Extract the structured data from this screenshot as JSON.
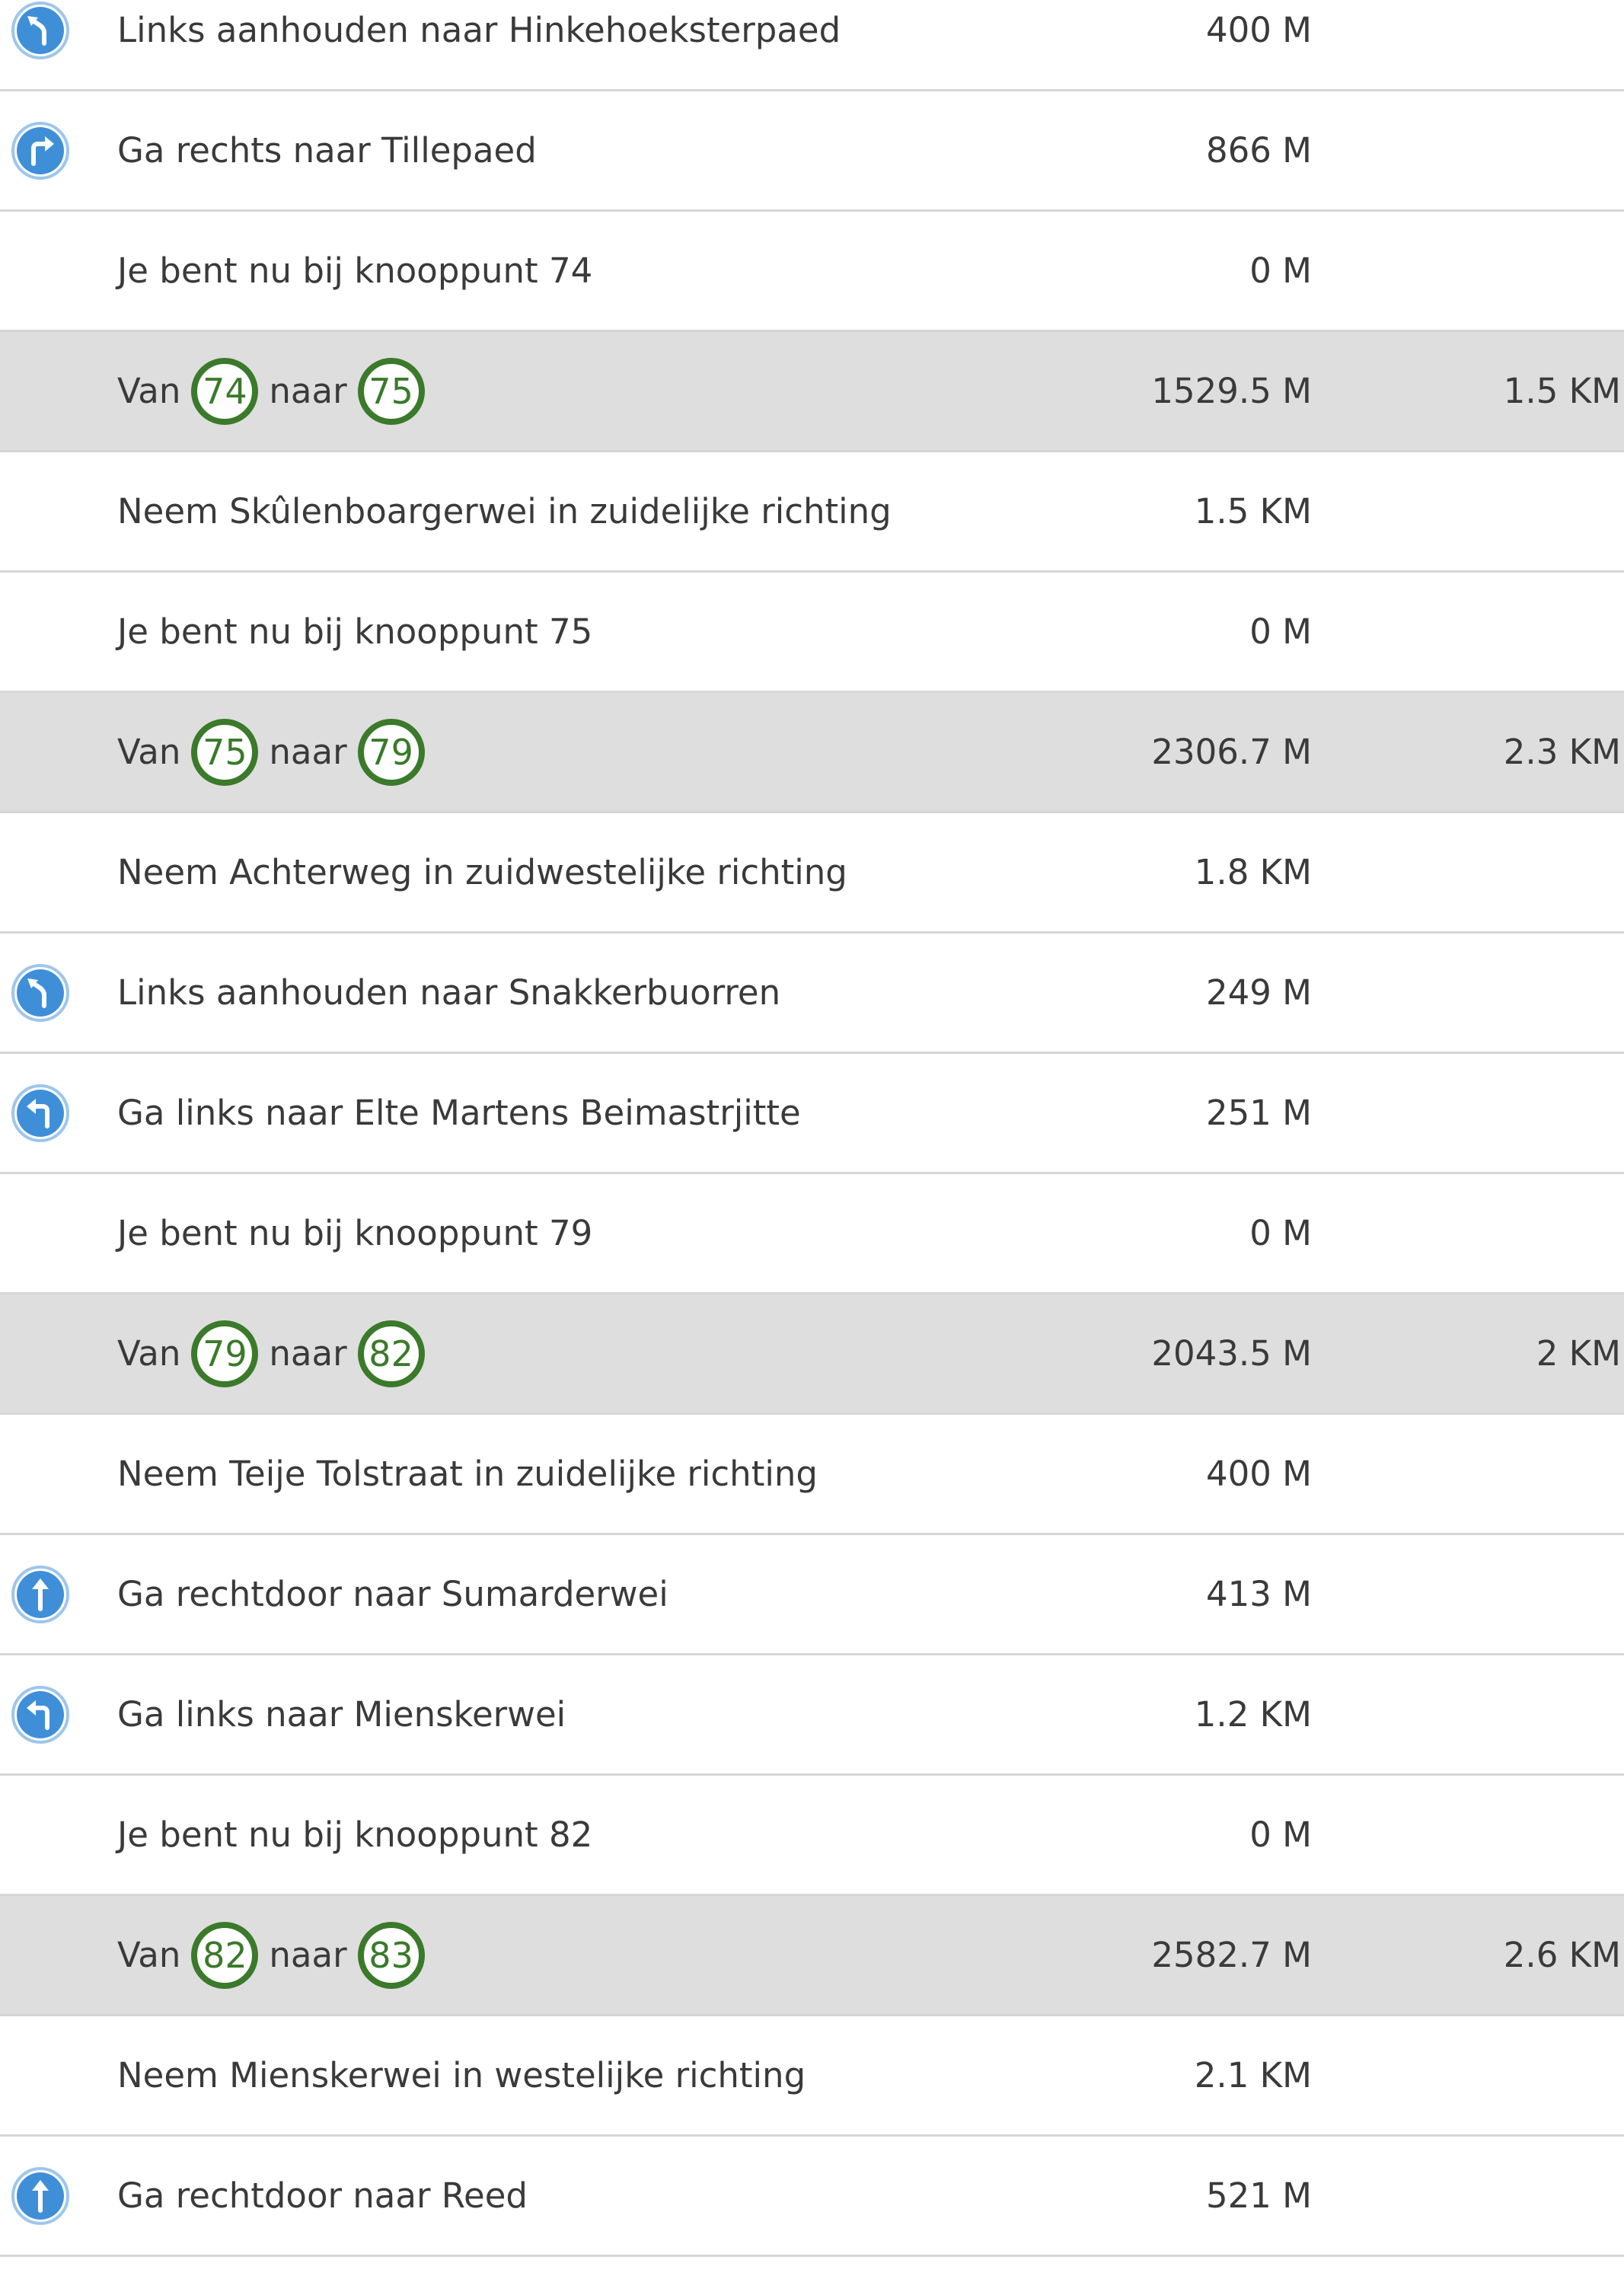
{
  "route": {
    "rows": [
      {
        "type": "step",
        "icon": "keep-left-icon",
        "text": "Links aanhouden naar Hinkehoeksterpaed",
        "distance": "400 M"
      },
      {
        "type": "step",
        "icon": "turn-right-icon",
        "text": "Ga rechts naar Tillepaed",
        "distance": "866 M"
      },
      {
        "type": "step",
        "icon": "",
        "text": "Je bent nu bij knooppunt 74",
        "distance": "0 M"
      },
      {
        "type": "segment",
        "from_label": "Van",
        "from": "74",
        "to_label": "naar",
        "to": "75",
        "distance": "1529.5 M",
        "total": "1.5 KM"
      },
      {
        "type": "step",
        "icon": "",
        "text": "Neem Skûlenboargerwei in zuidelijke richting",
        "distance": "1.5 KM"
      },
      {
        "type": "step",
        "icon": "",
        "text": "Je bent nu bij knooppunt 75",
        "distance": "0 M"
      },
      {
        "type": "segment",
        "from_label": "Van",
        "from": "75",
        "to_label": "naar",
        "to": "79",
        "distance": "2306.7 M",
        "total": "2.3 KM"
      },
      {
        "type": "step",
        "icon": "",
        "text": "Neem Achterweg in zuidwestelijke richting",
        "distance": "1.8 KM"
      },
      {
        "type": "step",
        "icon": "keep-left-icon",
        "text": "Links aanhouden naar Snakkerbuorren",
        "distance": "249 M"
      },
      {
        "type": "step",
        "icon": "turn-left-icon",
        "text": "Ga links naar Elte Martens Beimastrjitte",
        "distance": "251 M"
      },
      {
        "type": "step",
        "icon": "",
        "text": "Je bent nu bij knooppunt 79",
        "distance": "0 M"
      },
      {
        "type": "segment",
        "from_label": "Van",
        "from": "79",
        "to_label": "naar",
        "to": "82",
        "distance": "2043.5 M",
        "total": "2 KM"
      },
      {
        "type": "step",
        "icon": "",
        "text": "Neem Teije Tolstraat in zuidelijke richting",
        "distance": "400 M"
      },
      {
        "type": "step",
        "icon": "straight-icon",
        "text": "Ga rechtdoor naar Sumarderwei",
        "distance": "413 M"
      },
      {
        "type": "step",
        "icon": "turn-left-icon",
        "text": "Ga links naar Mienskerwei",
        "distance": "1.2 KM"
      },
      {
        "type": "step",
        "icon": "",
        "text": "Je bent nu bij knooppunt 82",
        "distance": "0 M"
      },
      {
        "type": "segment",
        "from_label": "Van",
        "from": "82",
        "to_label": "naar",
        "to": "83",
        "distance": "2582.7 M",
        "total": "2.6 KM"
      },
      {
        "type": "step",
        "icon": "",
        "text": "Neem Mienskerwei in westelijke richting",
        "distance": "2.1 KM"
      },
      {
        "type": "step",
        "icon": "straight-icon",
        "text": "Ga rechtdoor naar Reed",
        "distance": "521 M"
      }
    ]
  },
  "colors": {
    "icon_blue": "#3f8fd8",
    "node_green": "#3a7a2a",
    "segment_bg": "#dedede",
    "divider": "#d6d6d6",
    "text": "#3a3a3a"
  }
}
